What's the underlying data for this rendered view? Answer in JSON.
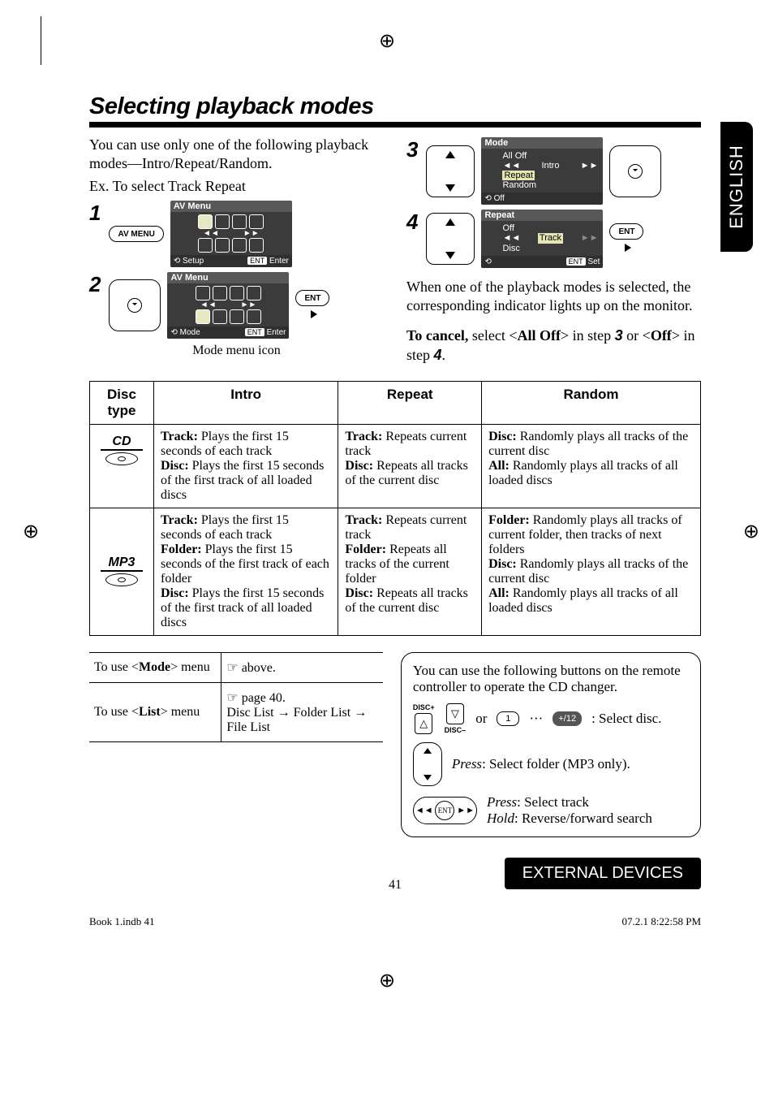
{
  "sideTab": "ENGLISH",
  "sectionTitle": "Selecting playback modes",
  "intro1": "You can use only one of the following playback modes—Intro/Repeat/Random.",
  "intro2": "Ex. To select Track Repeat",
  "steps": {
    "s1": "1",
    "s2": "2",
    "s3": "3",
    "s4": "4",
    "avMenuBtn": "AV MENU",
    "entBtn": "ENT",
    "screen1": {
      "title": "AV Menu",
      "left": "Setup",
      "right": "Enter",
      "rightBadge": "ENT"
    },
    "screen2": {
      "title": "AV Menu",
      "left": "Mode",
      "right": "Enter",
      "rightBadge": "ENT"
    },
    "caption2": "Mode menu icon",
    "screen3": {
      "title": "Mode",
      "opt1": "All Off",
      "opt2": "Intro",
      "opt3": "Repeat",
      "opt4": "Random",
      "left": "Off"
    },
    "screen4": {
      "title": "Repeat",
      "opt1": "Off",
      "opt2": "Track",
      "opt3": "Disc",
      "right": "Set",
      "rightBadge": "ENT"
    },
    "resultText": "When one of the playback modes is selected, the corresponding indicator lights up on the monitor.",
    "cancelPrefix": "To cancel,",
    "cancelText1": " select <",
    "cancelBold1": "All Off",
    "cancelText2": "> in step ",
    "cancelStep3": "3",
    "cancelText3": " or <",
    "cancelBold2": "Off",
    "cancelText4": "> in step ",
    "cancelStep4": "4",
    "cancelText5": "."
  },
  "modesTable": {
    "headers": {
      "disc": "Disc type",
      "intro": "Intro",
      "repeat": "Repeat",
      "random": "Random"
    },
    "row1": {
      "discLabel": "CD",
      "intro": {
        "t1": "Track:",
        "v1": " Plays the first 15 seconds of each track",
        "t2": "Disc:",
        "v2": " Plays the first 15 seconds of the first track of all loaded discs"
      },
      "repeat": {
        "t1": "Track:",
        "v1": " Repeats current track",
        "t2": "Disc:",
        "v2": " Repeats all tracks of the current disc"
      },
      "random": {
        "t1": "Disc:",
        "v1": " Randomly plays all tracks of the current disc",
        "t2": "All:",
        "v2": " Randomly plays all tracks of all loaded discs"
      }
    },
    "row2": {
      "discLabel": "MP3",
      "intro": {
        "t1": "Track:",
        "v1": " Plays the first 15 seconds of each track",
        "t2": "Folder:",
        "v2": " Plays the first 15 seconds of the first track of each folder",
        "t3": "Disc:",
        "v3": " Plays the first 15 seconds of the first track of all loaded discs"
      },
      "repeat": {
        "t1": "Track:",
        "v1": " Repeats current track",
        "t2": "Folder:",
        "v2": " Repeats all tracks of the current folder",
        "t3": "Disc:",
        "v3": " Repeats all tracks of the current disc"
      },
      "random": {
        "t1": "Folder:",
        "v1": " Randomly plays all tracks of current folder, then tracks of next folders",
        "t2": "Disc:",
        "v2": " Randomly plays all tracks of the current disc",
        "t3": "All:",
        "v3": " Randomly plays all tracks of all loaded discs"
      }
    }
  },
  "submenu": {
    "row1a": "To use <",
    "row1b": "Mode",
    "row1c": "> menu",
    "row1val": " above.",
    "row2a": "To use <",
    "row2b": "List",
    "row2c": "> menu",
    "row2val1": " page 40.",
    "row2val2": "Disc List → Folder List → File List"
  },
  "remoteBox": {
    "intro": "You can use the following buttons on the remote controller to operate the CD changer.",
    "discPlus": "DISC+",
    "discMinus": "DISC–",
    "upGlyph": "△",
    "dnGlyph": "▽",
    "or": "or",
    "key1": "1",
    "keyDots": "···",
    "key12": "+/12",
    "selectDisc": " : Select disc.",
    "pressLabel": "Press",
    "holdLabel": "Hold",
    "folderText": ":   Select folder (MP3 only).",
    "trackText": ":   Select track",
    "revText": ":    Reverse/forward search"
  },
  "pageNumber": "41",
  "bottomTab": "EXTERNAL DEVICES",
  "footer": {
    "left": "Book 1.indb   41",
    "right": "07.2.1   8:22:58 PM"
  },
  "pointer": "☞"
}
